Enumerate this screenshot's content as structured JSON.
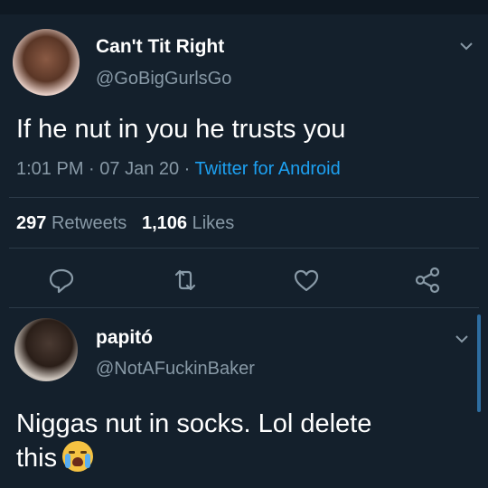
{
  "tweet": {
    "name": "Can't Tit Right",
    "handle": "@GoBigGurlsGo",
    "text": "If he nut in you he trusts you",
    "time": "1:01 PM",
    "separator": " · ",
    "date": "07 Jan 20",
    "client": "Twitter for Android",
    "retweets_count": "297",
    "retweets_label": "Retweets",
    "likes_count": "1,106",
    "likes_label": "Likes",
    "icons": [
      "reply-icon",
      "retweet-icon",
      "like-icon",
      "share-icon"
    ]
  },
  "reply": {
    "name": "papitó",
    "handle": "@NotAFuckinBaker",
    "text_line1": "Niggas nut in socks. Lol delete",
    "text_line2": "this",
    "emoji": "loudly-crying-face-icon"
  },
  "colors": {
    "background": "#14202c",
    "secondary_text": "#8899a6",
    "link": "#1da1f2",
    "divider": "#2c3a48"
  }
}
